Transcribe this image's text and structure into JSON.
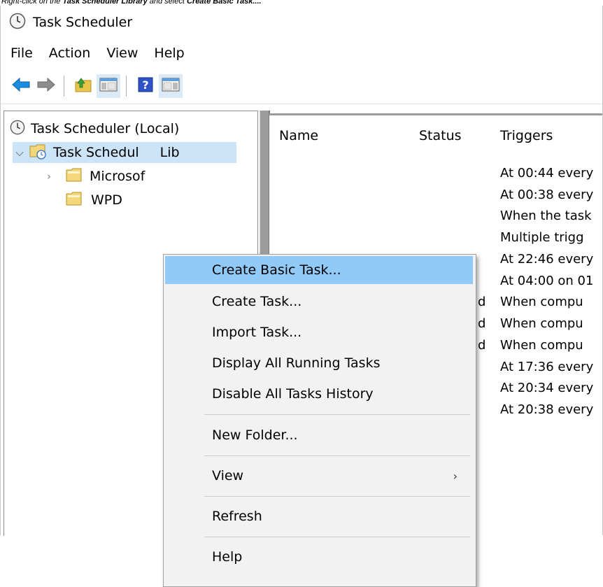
{
  "caption": {
    "prefix": "Right-click on the ",
    "bold1": "Task Scheduler Library",
    "middle": " and select ",
    "bold2": "Create Basic Task...."
  },
  "window": {
    "title": "Task Scheduler"
  },
  "menubar": [
    "File",
    "Action",
    "View",
    "Help"
  ],
  "toolbar": {
    "icons": [
      "back-arrow-icon",
      "forward-arrow-icon",
      "folder-up-icon",
      "show-hide-console-tree-icon",
      "help-icon",
      "show-hide-action-pane-icon"
    ]
  },
  "tree": {
    "root": "Task Scheduler (Local)",
    "library": "Task Schedul",
    "library_tail": "Lib",
    "children": [
      "Microsof",
      "WPD"
    ]
  },
  "list": {
    "columns": [
      "Name",
      "Status",
      "Triggers"
    ],
    "status_fragments": [
      "d",
      "d",
      "d"
    ],
    "triggers": [
      "At 00:44 every",
      "At 00:38 every",
      "When the task",
      "Multiple trigg",
      "At 22:46 every",
      "At 04:00 on 01",
      "When compu",
      "When compu",
      "When compu",
      "At 17:36 every",
      "At 20:34 every",
      "At 20:38 every"
    ]
  },
  "context_menu": {
    "items": [
      "Create Basic Task...",
      "Create Task...",
      "Import Task...",
      "Display All Running Tasks",
      "Disable All Tasks History",
      "New Folder...",
      "View",
      "Refresh",
      "Help"
    ],
    "highlighted": "Create Basic Task...",
    "submenu_item": "View"
  },
  "colors": {
    "menu_highlight": "#91c9f7",
    "tree_selection": "#cce4f7",
    "menu_background": "#f2f2f2"
  }
}
